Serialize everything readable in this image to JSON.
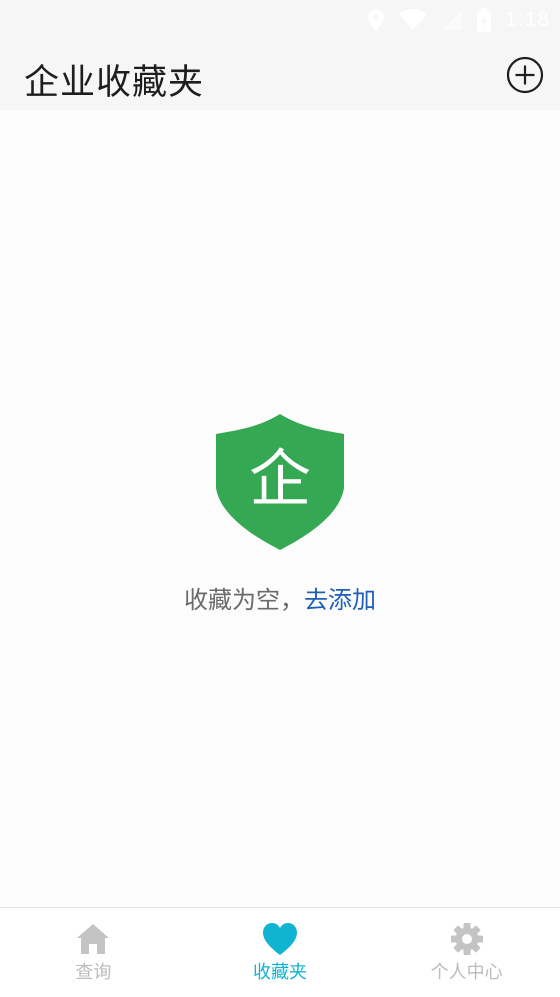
{
  "status_bar": {
    "time": "1:18",
    "icons": [
      "location-icon",
      "wifi-icon",
      "signal-icon",
      "battery-icon"
    ]
  },
  "header": {
    "title": "企业收藏夹",
    "add_icon": "plus-circle-icon"
  },
  "empty_state": {
    "logo_char": "企",
    "message": "收藏为空，",
    "link_text": "去添加",
    "logo_color": "#34a853",
    "link_color": "#1e5fb8"
  },
  "bottom_nav": {
    "items": [
      {
        "label": "查询",
        "icon": "home-icon",
        "active": false
      },
      {
        "label": "收藏夹",
        "icon": "heart-icon",
        "active": true
      },
      {
        "label": "个人中心",
        "icon": "gear-icon",
        "active": false
      }
    ],
    "active_color": "#11b3d2",
    "inactive_color": "#bcbcbc"
  }
}
